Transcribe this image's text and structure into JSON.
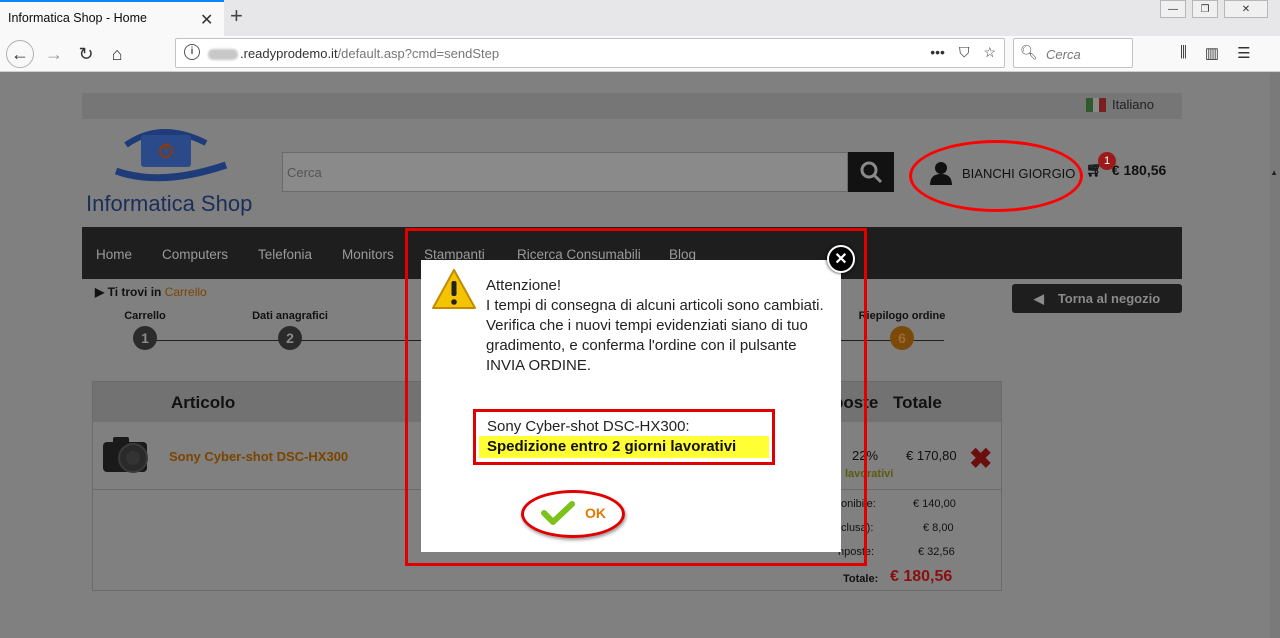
{
  "browser": {
    "tab_title": "Informatica Shop - Home",
    "url_domain": ".readyprodemo.it",
    "url_path": "/default.asp?cmd=sendStep",
    "search_placeholder": "Cerca"
  },
  "header": {
    "language": "Italiano",
    "logo_text": "Informatica Shop",
    "search_placeholder": "Cerca",
    "user_name": "BIANCHI GIORGIO",
    "cart_count": "1",
    "cart_total": "€ 180,56"
  },
  "menu": [
    "Home",
    "Computers",
    "Telefonia",
    "Monitors",
    "Stampanti",
    "Ricerca Consumabili",
    "Blog"
  ],
  "breadcrumb": {
    "prefix": "Ti trovi in",
    "link": "Carrello"
  },
  "back_to_shop": "Torna al negozio",
  "steps": [
    {
      "label": "Carrello",
      "num": "1"
    },
    {
      "label": "Dati anagrafici",
      "num": "2"
    },
    {
      "label": "Riepilogo ordine",
      "num": "6"
    }
  ],
  "cart_table": {
    "col_article": "Articolo",
    "col_tax": "poste",
    "col_total": "Totale",
    "item_name": "Sony Cyber-shot DSC-HX300",
    "item_tax": "22%",
    "item_total": "€ 170,80",
    "shipping_note": "lavorativi",
    "summary": [
      {
        "label": "onibile:",
        "value": "€ 140,00"
      },
      {
        "label": "clusa):",
        "value": "€ 8,00"
      },
      {
        "label": "nposte:",
        "value": "€ 32,56"
      }
    ],
    "grand_label": "Totale:",
    "grand_total": "€ 180,56"
  },
  "modal": {
    "lines": [
      "Attenzione!",
      "I tempi di consegna di alcuni articoli sono cambiati.",
      "Verifica che i nuovi tempi evidenziati siano di tuo gradimento, e conferma l'ordine con il pulsante INVIA ORDINE."
    ],
    "product_name": "Sony Cyber-shot DSC-HX300:",
    "product_shipping": "Spedizione entro 2 giorni lavorativi",
    "ok_label": "OK"
  },
  "colors": {
    "highlight_red": "#e00000",
    "highlight_yellow": "#ffff33",
    "ok_orange": "#e07b00",
    "check_green": "#7cc21c"
  }
}
